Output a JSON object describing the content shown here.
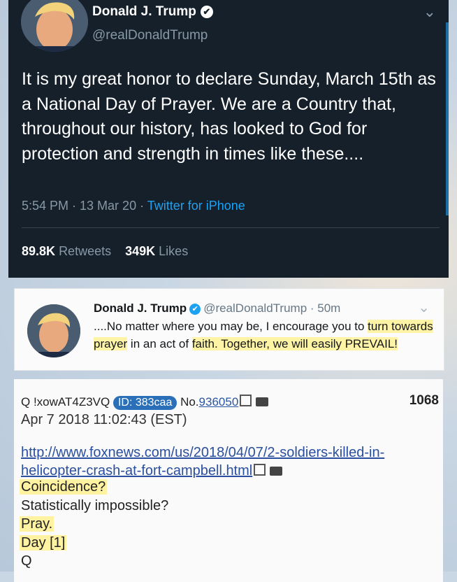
{
  "dark_tweet": {
    "name": "Donald J. Trump",
    "handle": "@realDonaldTrump",
    "text": "It is my great honor to declare Sunday, March 15th as a National Day of Prayer. We are a Country that, throughout our history, has looked to God for protection and strength in times like these....",
    "time": "5:54 PM · 13 Mar 20 · ",
    "source": "Twitter for iPhone",
    "retweets_count": "89.8K",
    "retweets_label": "Retweets",
    "likes_count": "349K",
    "likes_label": "Likes"
  },
  "light_tweet": {
    "name": "Donald J. Trump",
    "handle": "@realDonaldTrump",
    "time": "· 50m",
    "text_a": "....No matter where you may be, I encourage you to ",
    "text_b": "turn towards prayer",
    "text_c": " in an act of ",
    "text_d": "faith. Together, we will easily PREVAIL!"
  },
  "q_post": {
    "poster": "Q !xowAT4Z3VQ",
    "id_label": "ID: 383caa",
    "no_prefix": "No.",
    "post_number": "936050",
    "reply_count": "1068",
    "date": "Apr 7 2018 11:02:43 (EST)",
    "link": "http://www.foxnews.com/us/2018/04/07/2-soldiers-killed-in-helicopter-crash-at-fort-campbell.html",
    "line_1": "Coincidence?",
    "line_2": "Statistically impossible?",
    "line_3": "Pray.",
    "line_4": "Day [1]",
    "line_5": "Q"
  },
  "icons": [
    "verified-icon",
    "chevron-down-icon",
    "external-link-icon",
    "folder-icon"
  ]
}
